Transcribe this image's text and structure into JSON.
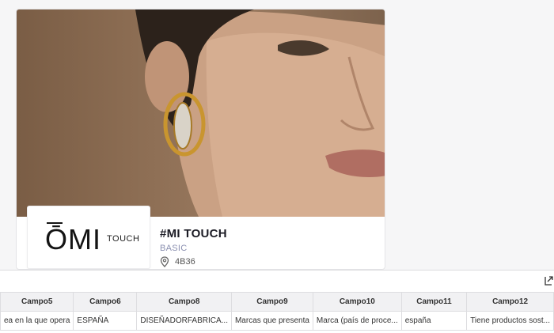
{
  "exhibitor": {
    "name": "#MI TOUCH",
    "tier": "BASIC",
    "location": "4B36",
    "logo": {
      "main": "ŌMI",
      "sub": "TOUCH"
    }
  },
  "table": {
    "columns": [
      "Campo5",
      "Campo6",
      "Campo8",
      "Campo9",
      "Campo10",
      "Campo11",
      "Campo12"
    ],
    "rows": [
      [
        "ea en la que opera",
        "ESPAÑA",
        "DISEÑADORFABRICA...",
        "Marcas que presenta",
        "Marca (país de proce...",
        "españa",
        "Tiene productos sost..."
      ]
    ]
  }
}
